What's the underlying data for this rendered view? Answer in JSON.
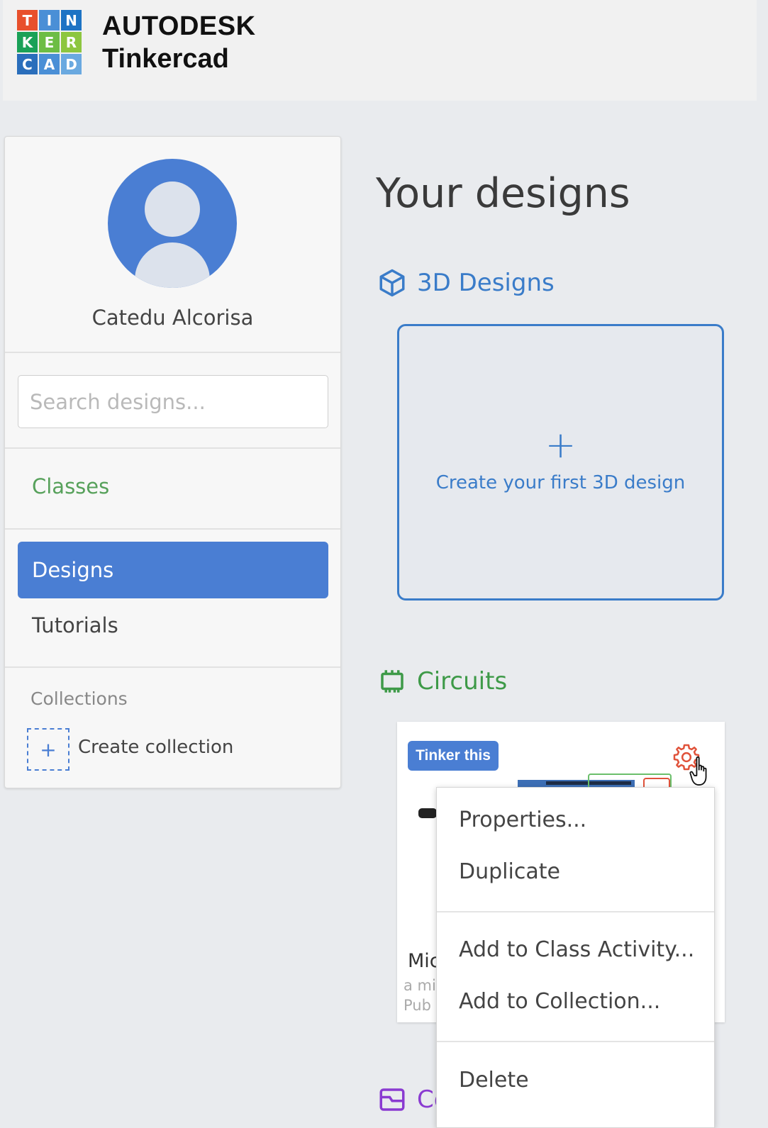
{
  "header": {
    "logo_letters": [
      "T",
      "I",
      "N",
      "K",
      "E",
      "R",
      "C",
      "A",
      "D"
    ],
    "logo_colors": [
      "#e8502c",
      "#4a8fd6",
      "#1d73c4",
      "#1aa157",
      "#6dbd45",
      "#8dc63f",
      "#2a6ebb",
      "#4a8fd6",
      "#6aa9e0"
    ],
    "brand_line1": "AUTODESK",
    "brand_line2": "Tinkercad"
  },
  "sidebar": {
    "username": "Catedu Alcorisa",
    "search_placeholder": "Search designs...",
    "nav": {
      "classes": "Classes",
      "designs": "Designs",
      "tutorials": "Tutorials"
    },
    "collections": {
      "heading": "Collections",
      "create_label": "Create collection"
    }
  },
  "main": {
    "title": "Your designs",
    "sections": {
      "designs_3d": "3D Designs",
      "circuits": "Circuits",
      "codeblocks_partial": "Co"
    },
    "create_card": {
      "plus": "+",
      "label": "Create your first 3D design"
    },
    "circuit_card": {
      "badge": "Tinker this",
      "title_partial": "Mic",
      "subtitle_partial": "a mi",
      "visibility_partial": "Pub"
    }
  },
  "context_menu": {
    "items": [
      "Properties...",
      "Duplicate",
      "Add to Class Activity...",
      "Add to Collection...",
      "Delete"
    ]
  },
  "colors": {
    "accent_blue": "#4a7ed3",
    "link_blue": "#3a7cc9",
    "circuits_green": "#3e9a48",
    "classes_green": "#57a15b",
    "codeblocks_purple": "#8a3bd1",
    "gear_red": "#e0523a"
  }
}
